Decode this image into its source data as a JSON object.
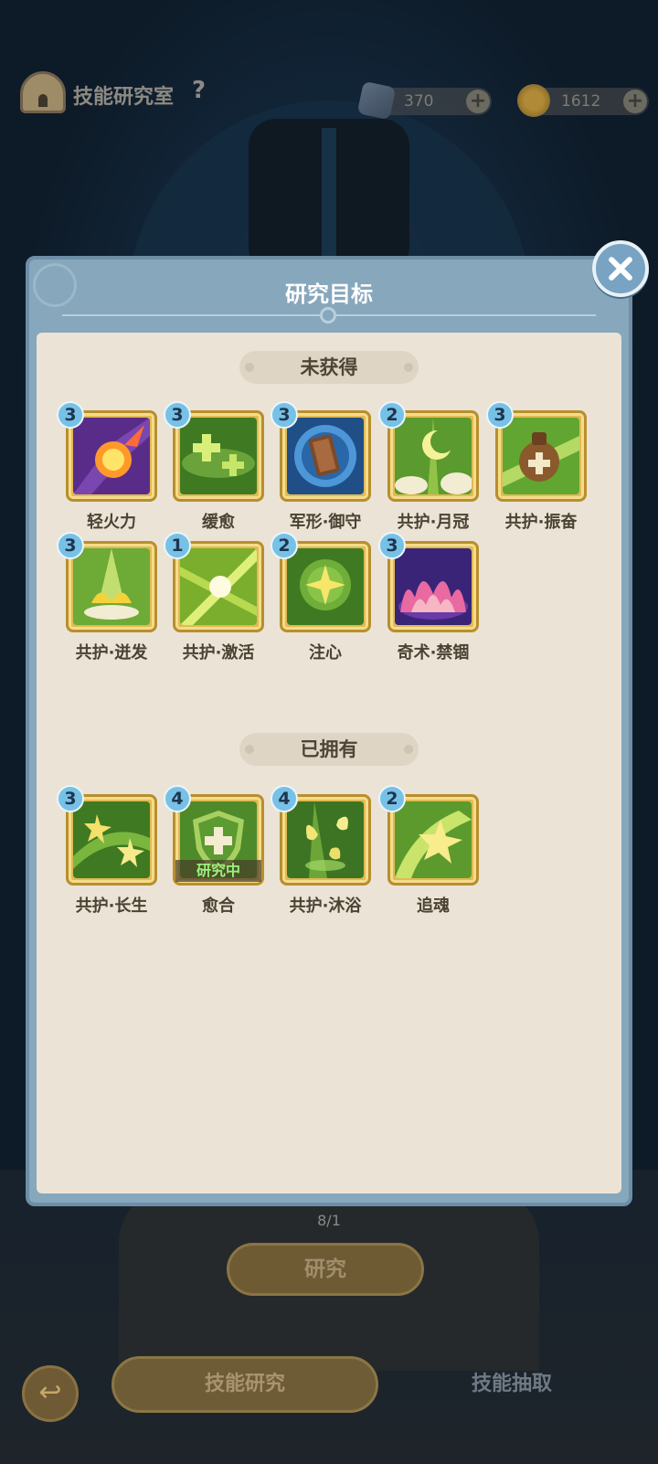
{
  "header": {
    "title": "技能研究室",
    "help": "?",
    "currencies": [
      {
        "name": "gem",
        "value": "370"
      },
      {
        "name": "coin",
        "value": "1612"
      }
    ]
  },
  "dialog": {
    "title": "研究目标",
    "sections": {
      "not_obtained": "未获得",
      "owned": "已拥有"
    }
  },
  "skills_not_obtained": [
    {
      "name": "轻火力",
      "level": "3",
      "icon": "fire-meteor-icon"
    },
    {
      "name": "缓愈",
      "level": "3",
      "icon": "heal-crosses-icon"
    },
    {
      "name": "军形·御守",
      "level": "3",
      "icon": "shield-book-icon"
    },
    {
      "name": "共护·月冠",
      "level": "2",
      "icon": "moon-crown-icon"
    },
    {
      "name": "共护·振奋",
      "level": "3",
      "icon": "potion-jar-icon"
    },
    {
      "name": "共护·迸发",
      "level": "3",
      "icon": "lotus-burst-icon"
    },
    {
      "name": "共护·激活",
      "level": "1",
      "icon": "activate-flash-icon"
    },
    {
      "name": "注心",
      "level": "2",
      "icon": "star-orb-icon"
    },
    {
      "name": "奇术·禁锢",
      "level": "3",
      "icon": "purple-flames-icon"
    }
  ],
  "skills_owned": [
    {
      "name": "共护·长生",
      "level": "3",
      "icon": "shooting-stars-icon"
    },
    {
      "name": "愈合",
      "level": "4",
      "icon": "heal-shield-icon",
      "status": "研究中"
    },
    {
      "name": "共护·沐浴",
      "level": "4",
      "icon": "butterflies-icon"
    },
    {
      "name": "追魂",
      "level": "2",
      "icon": "star-swirl-icon"
    }
  ],
  "footer": {
    "research_count": "8/1",
    "research_button": "研究",
    "back": "↩",
    "tab_research": "技能研究",
    "tab_draw": "技能抽取"
  }
}
